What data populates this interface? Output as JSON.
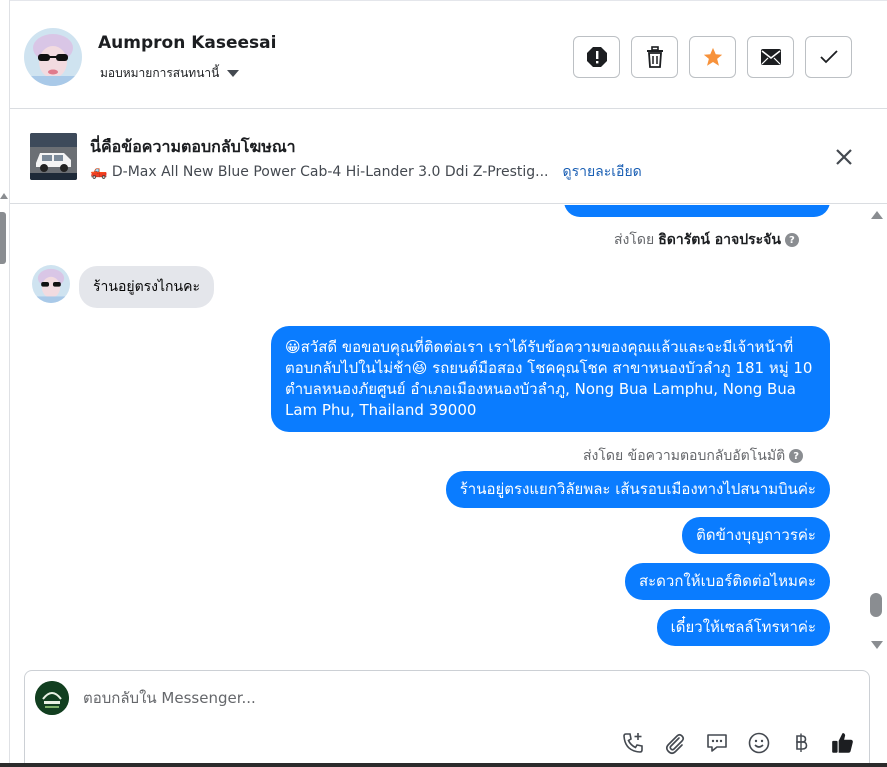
{
  "header": {
    "contact_name": "Aumpron Kaseesai",
    "assign_label": "มอบหมายการสนทนานี้",
    "actions": [
      "spam-icon",
      "trash-icon",
      "star-icon",
      "mail-icon",
      "check-icon"
    ]
  },
  "ad": {
    "title": "นี่คือข้อความตอบกลับโฆษณา",
    "product": "🛻 D-Max All New Blue Power Cab-4 Hi-Lander 3.0 Ddi Z-Prestig...",
    "details_link": "ดูรายละเอียด"
  },
  "thread": {
    "sent_by_1_prefix": "ส่งโดย",
    "sent_by_1_name": "ธิดารัตน์ อาจประจัน",
    "incoming_1": "ร้านอยู่ตรงไกนคะ",
    "auto_reply": "😀สวัสดี ขอขอบคุณที่ติดต่อเรา เราได้รับข้อความของคุณแล้วและจะมีเจ้าหน้าที่ตอบกลับไปในไม่ช้า😆 รถยนต์มือสอง โชคคุณโชค สาขาหนองบัวลำภู 181 หมู่ 10 ตำบลหนองภัยศูนย์ อำเภอเมืองหนองบัวลำภู, Nong Bua Lamphu, Nong Bua Lam Phu, Thailand 39000",
    "sent_by_2": "ส่งโดย ข้อความตอบกลับอัตโนมัติ",
    "outgoing": [
      "ร้านอยู่ตรงแยกวิลัยพละ เส้นรอบเมืองทางไปสนามบินค่ะ",
      "ติดข้างบุญถาวรค่ะ",
      "สะดวกให้เบอร์ติดต่อไหมคะ",
      "เดี๋ยวให้เซลล์โทรหาค่ะ"
    ]
  },
  "composer": {
    "placeholder": "ตอบกลับใน Messenger...",
    "tools": [
      "phone-plus-icon",
      "paperclip-icon",
      "saved-reply-icon",
      "emoji-icon",
      "baht-icon",
      "thumbs-up-icon"
    ]
  },
  "colors": {
    "accent": "#0a7cff",
    "star": "#f7923b",
    "incoming_bg": "#e4e6eb"
  }
}
